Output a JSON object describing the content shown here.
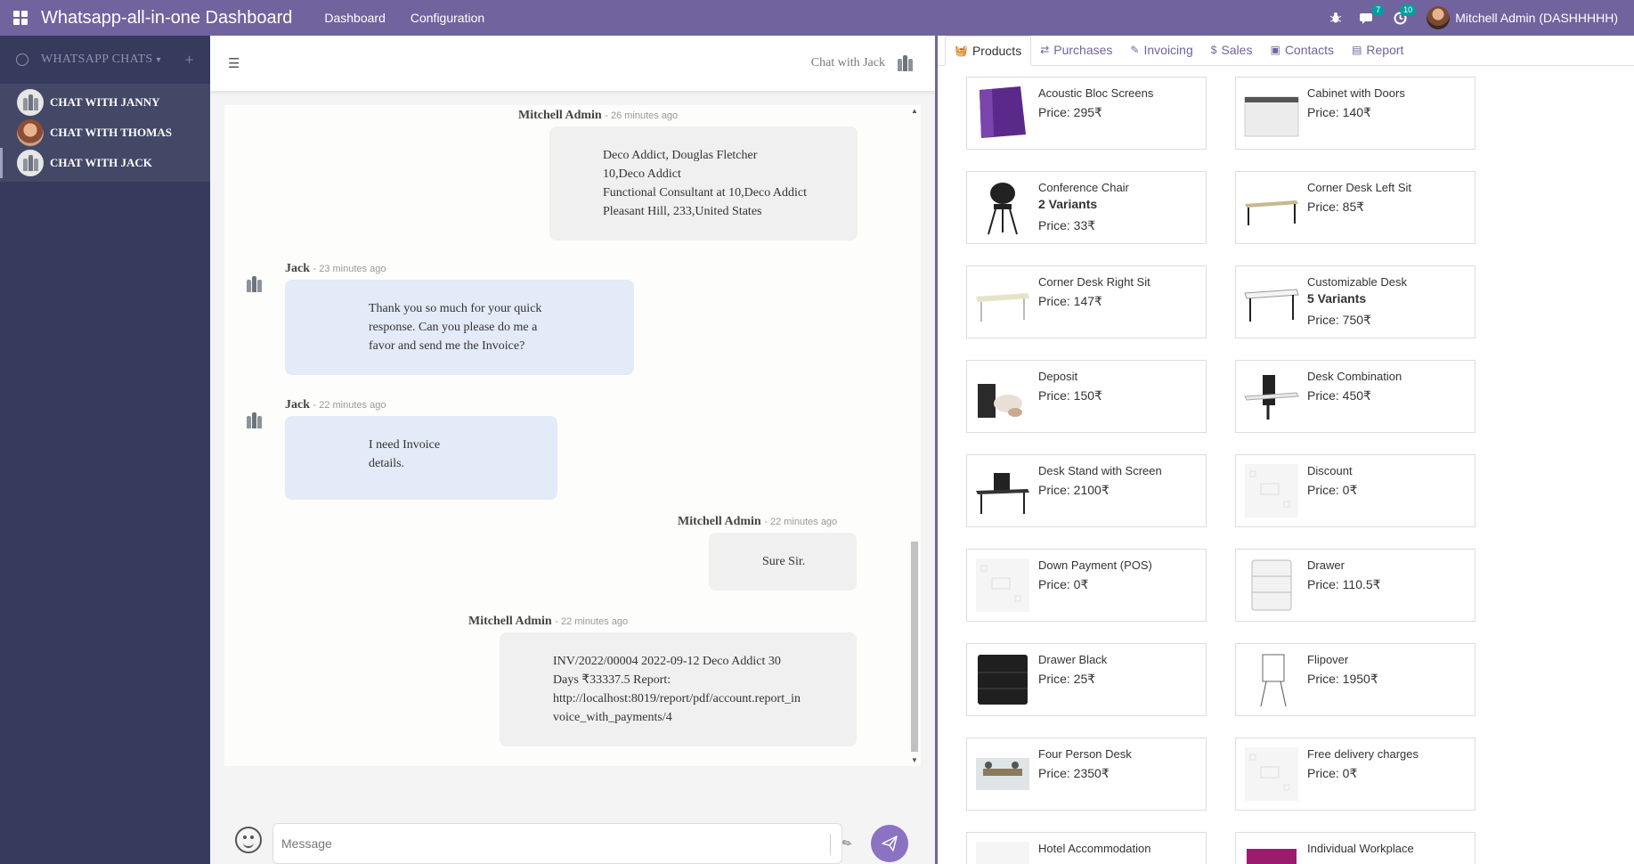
{
  "topbar": {
    "brand": "Whatsapp-all-in-one Dashboard",
    "menu": [
      "Dashboard",
      "Configuration"
    ],
    "messages_badge": "7",
    "activities_badge": "10",
    "user": "Mitchell Admin (DASHHHHH)"
  },
  "sidebar": {
    "header": "WHATSAPP CHATS",
    "chats": [
      {
        "label": "CHAT WITH JANNY"
      },
      {
        "label": "CHAT WITH THOMAS"
      },
      {
        "label": "CHAT WITH JACK"
      }
    ]
  },
  "chat": {
    "title": "Chat with Jack",
    "messages": [
      {
        "author": "Mitchell Admin",
        "time": "- 26 minutes ago",
        "lines": [
          "Deco Addict, Douglas Fletcher",
          "10,Deco Addict",
          "Functional Consultant at 10,Deco Addict",
          "Pleasant Hill, 233,United States"
        ]
      },
      {
        "author": "Jack",
        "time": "- 23 minutes ago",
        "lines": [
          "Thank you so much for your quick",
          "response. Can you please do me a",
          "favor and send me the Invoice?"
        ]
      },
      {
        "author": "Jack",
        "time": "- 22 minutes ago",
        "lines": [
          "I need Invoice",
          "details."
        ]
      },
      {
        "author": "Mitchell Admin",
        "time": "- 22 minutes ago",
        "lines": [
          "Sure Sir."
        ]
      },
      {
        "author": "Mitchell Admin",
        "time": "- 22 minutes ago",
        "lines": [
          "INV/2022/00004 2022-09-12 Deco Addict 30",
          "Days ₹33337.5 Report:",
          "http://localhost:8019/report/pdf/account.report_in",
          "voice_with_payments/4"
        ]
      }
    ],
    "composer_placeholder": "Message"
  },
  "tabs": [
    {
      "label": "Products",
      "icon": "basket-icon"
    },
    {
      "label": "Purchases",
      "icon": "exchange-icon"
    },
    {
      "label": "Invoicing",
      "icon": "pencil-icon"
    },
    {
      "label": "Sales",
      "icon": "dollar-icon"
    },
    {
      "label": "Contacts",
      "icon": "contact-icon"
    },
    {
      "label": "Report",
      "icon": "report-icon"
    }
  ],
  "products": [
    {
      "name": "Acoustic Bloc Screens",
      "price": "Price: 295₹",
      "variants": ""
    },
    {
      "name": "Cabinet with Doors",
      "price": "Price: 140₹",
      "variants": ""
    },
    {
      "name": "Conference Chair",
      "price": "Price: 33₹",
      "variants": "2 Variants"
    },
    {
      "name": "Corner Desk Left Sit",
      "price": "Price: 85₹",
      "variants": ""
    },
    {
      "name": "Corner Desk Right Sit",
      "price": "Price: 147₹",
      "variants": ""
    },
    {
      "name": "Customizable Desk",
      "price": "Price: 750₹",
      "variants": "5 Variants"
    },
    {
      "name": "Deposit",
      "price": "Price: 150₹",
      "variants": ""
    },
    {
      "name": "Desk Combination",
      "price": "Price: 450₹",
      "variants": ""
    },
    {
      "name": "Desk Stand with Screen",
      "price": "Price: 2100₹",
      "variants": ""
    },
    {
      "name": "Discount",
      "price": "Price: 0₹",
      "variants": ""
    },
    {
      "name": "Down Payment (POS)",
      "price": "Price: 0₹",
      "variants": ""
    },
    {
      "name": "Drawer",
      "price": "Price: 110.5₹",
      "variants": ""
    },
    {
      "name": "Drawer Black",
      "price": "Price: 25₹",
      "variants": ""
    },
    {
      "name": "Flipover",
      "price": "Price: 1950₹",
      "variants": ""
    },
    {
      "name": "Four Person Desk",
      "price": "Price: 2350₹",
      "variants": ""
    },
    {
      "name": "Free delivery charges",
      "price": "Price: 0₹",
      "variants": ""
    },
    {
      "name": "Hotel Accommodation",
      "price": "",
      "variants": ""
    },
    {
      "name": "Individual Workplace",
      "price": "",
      "variants": ""
    }
  ],
  "colors": {
    "brand": "#71639e",
    "sidebar": "#363b5d",
    "send": "#8b72c2",
    "badge": "#00a09d"
  }
}
